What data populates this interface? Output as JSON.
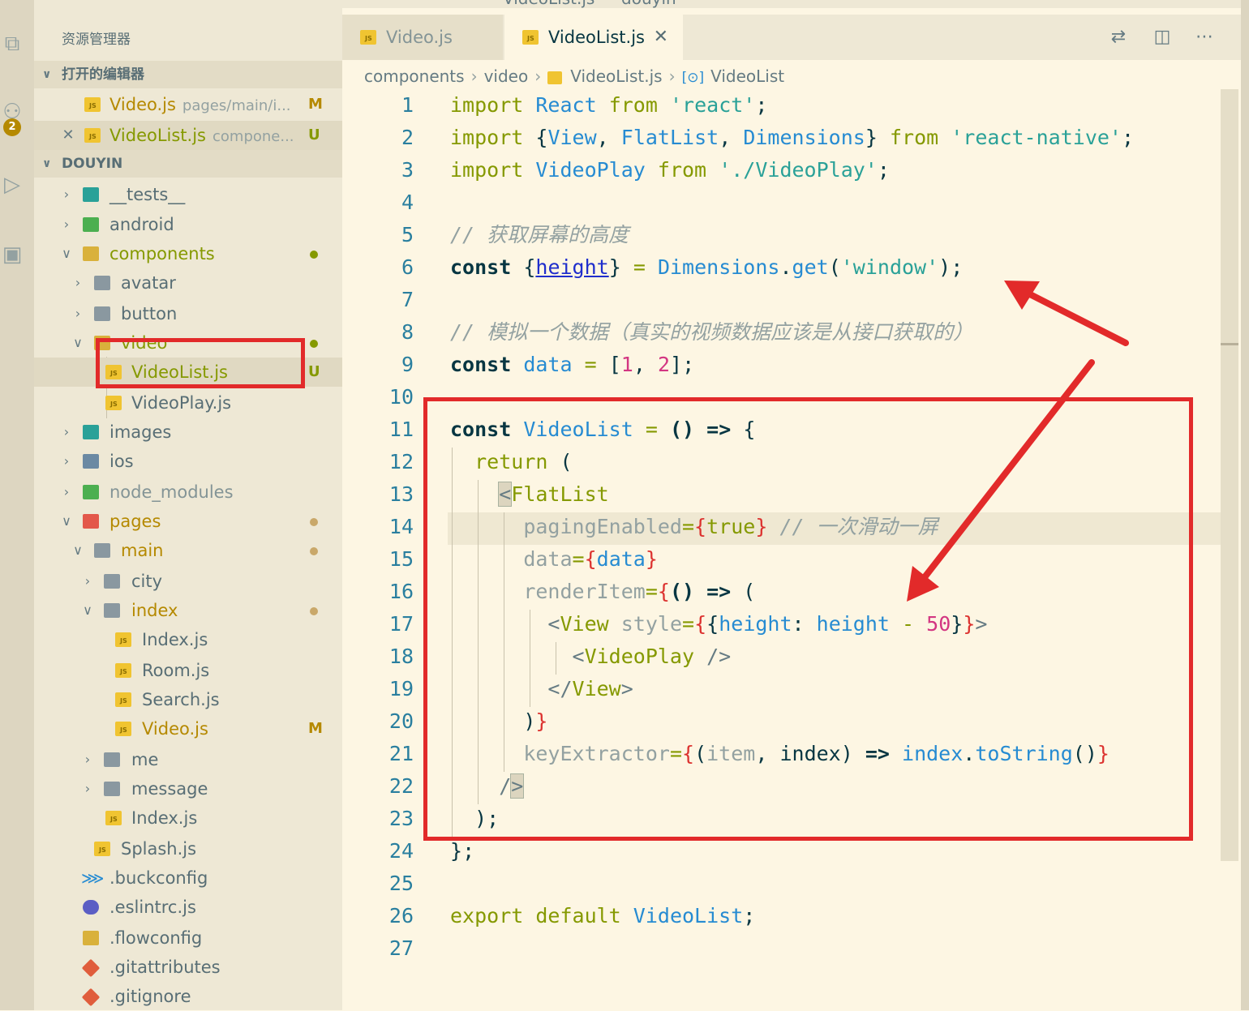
{
  "window": {
    "title": "VideoList.js — douyin"
  },
  "activity": {
    "scm_badge": "2"
  },
  "sidebar": {
    "title": "资源管理器",
    "open_editors": {
      "header": "打开的编辑器",
      "items": [
        {
          "name": "Video.js",
          "desc": "pages/main/i...",
          "status": "M"
        },
        {
          "name": "VideoList.js",
          "desc": "compone...",
          "status": "U"
        }
      ]
    },
    "project": {
      "header": "DOUYIN",
      "items": [
        {
          "label": "__tests__"
        },
        {
          "label": "android"
        },
        {
          "label": "components"
        },
        {
          "label": "avatar"
        },
        {
          "label": "button"
        },
        {
          "label": "video"
        },
        {
          "label": "VideoList.js",
          "status": "U"
        },
        {
          "label": "VideoPlay.js"
        },
        {
          "label": "images"
        },
        {
          "label": "ios"
        },
        {
          "label": "node_modules"
        },
        {
          "label": "pages"
        },
        {
          "label": "main"
        },
        {
          "label": "city"
        },
        {
          "label": "index"
        },
        {
          "label": "Index.js"
        },
        {
          "label": "Room.js"
        },
        {
          "label": "Search.js"
        },
        {
          "label": "Video.js",
          "status": "M"
        },
        {
          "label": "me"
        },
        {
          "label": "message"
        },
        {
          "label": "Index.js"
        },
        {
          "label": "Splash.js"
        },
        {
          "label": ".buckconfig"
        },
        {
          "label": ".eslintrc.js"
        },
        {
          "label": ".flowconfig"
        },
        {
          "label": ".gitattributes"
        },
        {
          "label": ".gitignore"
        }
      ]
    }
  },
  "tabs": [
    {
      "label": "Video.js"
    },
    {
      "label": "VideoList.js",
      "close": "✕"
    }
  ],
  "breadcrumbs": {
    "part1": "components",
    "part2": "video",
    "part3": "VideoList.js",
    "symbol_icon": "[⊙]",
    "part4": "VideoList",
    "sep": "›"
  },
  "code": {
    "line_numbers": [
      "1",
      "2",
      "3",
      "4",
      "5",
      "6",
      "7",
      "8",
      "9",
      "10",
      "11",
      "12",
      "13",
      "14",
      "15",
      "16",
      "17",
      "18",
      "19",
      "20",
      "21",
      "22",
      "23",
      "24",
      "25",
      "26",
      "27"
    ],
    "t": {
      "import": "import",
      "from": "from",
      "React": "React",
      "react_str": "'react'",
      "semi": ";",
      "lbrace": "{",
      "rbrace": "}",
      "View": "View",
      "FlatList": "FlatList",
      "Dimensions": "Dimensions",
      "comma": ",",
      "rn_str": "'react-native'",
      "VideoPlay": "VideoPlay",
      "vp_str": "'./VideoPlay'",
      "c5": "// 获取屏幕的高度",
      "const": "const",
      "height": "height",
      "eq": "=",
      "dot": ".",
      "get": "get",
      "lparen": "(",
      "rparen": ")",
      "window_str": "'window'",
      "c8": "// 模拟一个数据（真实的视频数据应该是从接口获取的）",
      "data": "data",
      "lbrack": "[",
      "rbrack": "]",
      "one": "1",
      "two": "2",
      "VideoList": "VideoList",
      "arrow_fn": "() =>",
      "arrow": "=>",
      "return": "return",
      "lt": "<",
      "gt": ">",
      "pagingEnabled": "pagingEnabled",
      "true": "true",
      "c14": "// 一次滑动一屏",
      "renderItem": "renderItem",
      "style": "style",
      "colon": ":",
      "minus": "-",
      "fifty": "50",
      "selfclose": "/>",
      "close_view": "</",
      "keyExtractor": "keyExtractor",
      "item": "item",
      "index": "index",
      "toString": "toString",
      "parens": "()",
      "slash": "/",
      "export": "export",
      "default": "default"
    }
  }
}
